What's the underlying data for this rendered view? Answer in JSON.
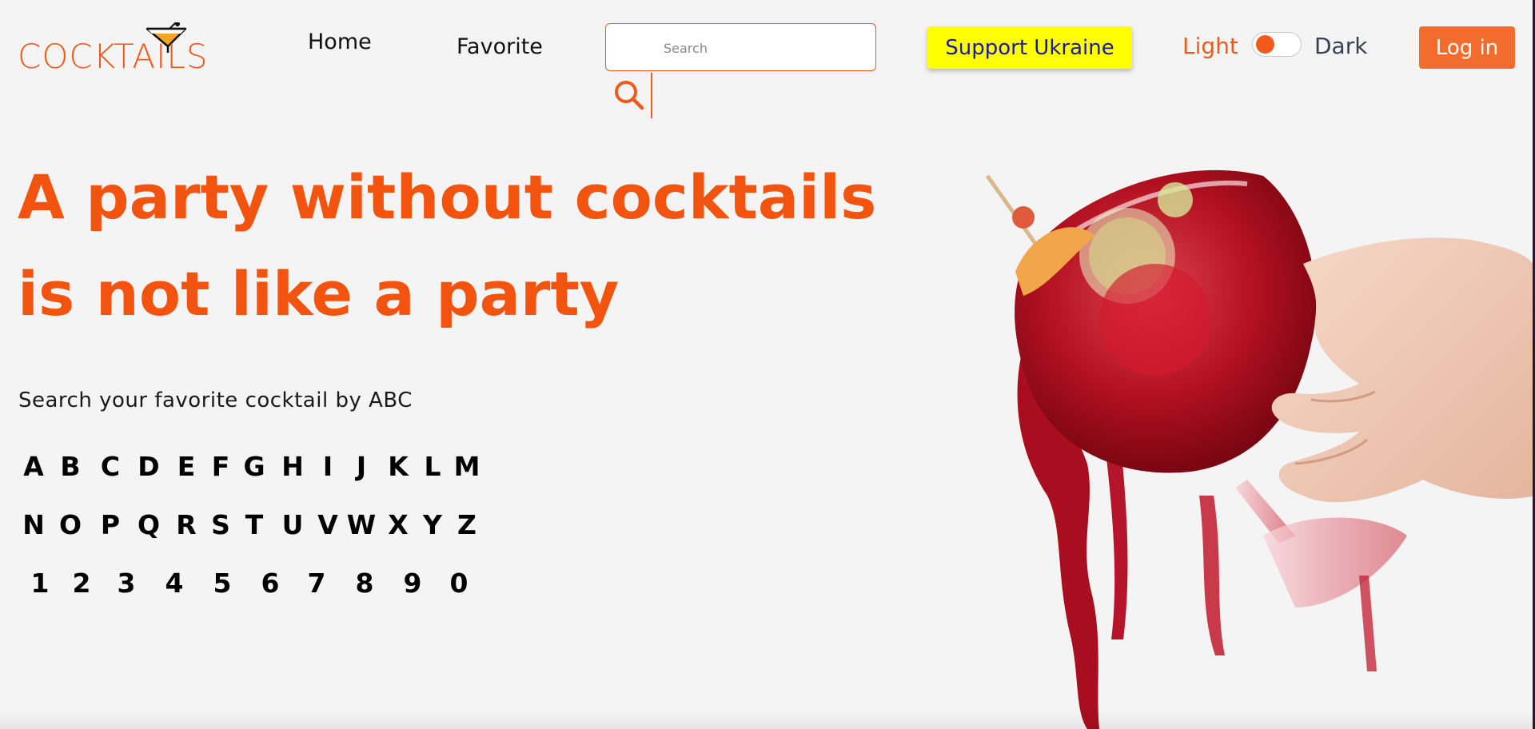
{
  "header": {
    "logo_text": "COCKTAILS",
    "nav": [
      {
        "label": "Home"
      },
      {
        "label": "Favorite"
      }
    ],
    "search": {
      "placeholder": "Search",
      "value": ""
    },
    "support_button": "Support Ukraine",
    "theme": {
      "light_label": "Light",
      "dark_label": "Dark",
      "state": "light"
    },
    "login_button": "Log in"
  },
  "hero": {
    "title_line1": "A party without cocktails",
    "title_line2": "is not like a party",
    "abc_subtitle": "Search your favorite cocktail by ABC",
    "rows": [
      [
        "A",
        "B",
        "C",
        "D",
        "E",
        "F",
        "G",
        "H",
        "I",
        "J",
        "K",
        "L",
        "M"
      ],
      [
        "N",
        "O",
        "P",
        "Q",
        "R",
        "S",
        "T",
        "U",
        "V",
        "W",
        "X",
        "Y",
        "Z"
      ],
      [
        "1",
        "2",
        "3",
        "4",
        "5",
        "6",
        "7",
        "8",
        "9",
        "0"
      ]
    ]
  },
  "colors": {
    "accent": "#f25a1c",
    "background": "#f4f4f4",
    "support_bg": "#ffff00",
    "support_text": "#1a1aa8",
    "login_bg": "#f26c2d"
  },
  "icons": {
    "logo": "cocktail-glass-icon",
    "search": "search-icon",
    "hero": "cocktail-splash-image"
  }
}
